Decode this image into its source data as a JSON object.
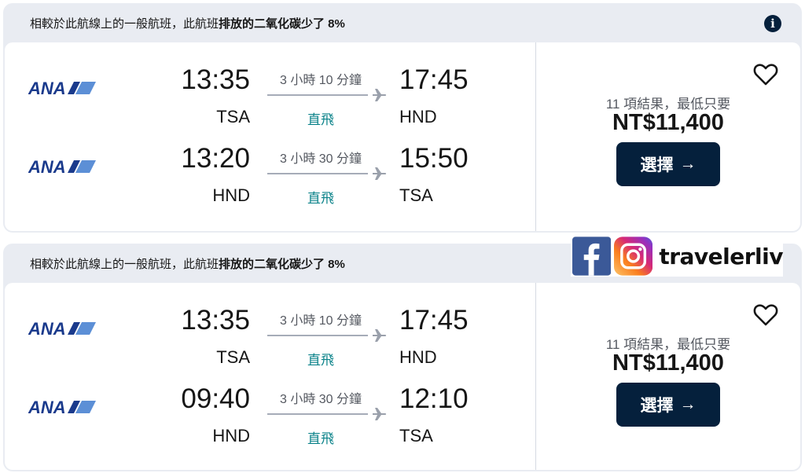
{
  "results": [
    {
      "eco_banner": {
        "text": "相較於此航線上的一般航班，此航班",
        "bold": "排放的二氧化碳少了 8%"
      },
      "legs": [
        {
          "airline": "ANA",
          "dep_time": "13:35",
          "dep_code": "TSA",
          "duration": "3 小時 10 分鐘",
          "stops": "直飛",
          "arr_time": "17:45",
          "arr_code": "HND"
        },
        {
          "airline": "ANA",
          "dep_time": "13:20",
          "dep_code": "HND",
          "duration": "3 小時 30 分鐘",
          "stops": "直飛",
          "arr_time": "15:50",
          "arr_code": "TSA"
        }
      ],
      "result_count": "11 項結果，最低只要",
      "price": "NT$11,400",
      "select_label": "選擇",
      "select_arrow": "→"
    },
    {
      "eco_banner": {
        "text": "相較於此航線上的一般航班，此航班",
        "bold": "排放的二氧化碳少了 8%"
      },
      "legs": [
        {
          "airline": "ANA",
          "dep_time": "13:35",
          "dep_code": "TSA",
          "duration": "3 小時 10 分鐘",
          "stops": "直飛",
          "arr_time": "17:45",
          "arr_code": "HND"
        },
        {
          "airline": "ANA",
          "dep_time": "09:40",
          "dep_code": "HND",
          "duration": "3 小時 30 分鐘",
          "stops": "直飛",
          "arr_time": "12:10",
          "arr_code": "TSA"
        }
      ],
      "result_count": "11 項結果，最低只要",
      "price": "NT$11,400",
      "select_label": "選擇",
      "select_arrow": "→"
    }
  ],
  "info_icon": {
    "symbol": "i",
    "icon": "info-icon"
  },
  "watermark": {
    "handle": "travelerliv",
    "icons": [
      "facebook-icon",
      "instagram-icon"
    ]
  },
  "colors": {
    "navy": "#05203c",
    "banner_bg": "#e9ecf2",
    "stops_teal": "#0c838a",
    "ana_blue": "#1a3a8c"
  }
}
